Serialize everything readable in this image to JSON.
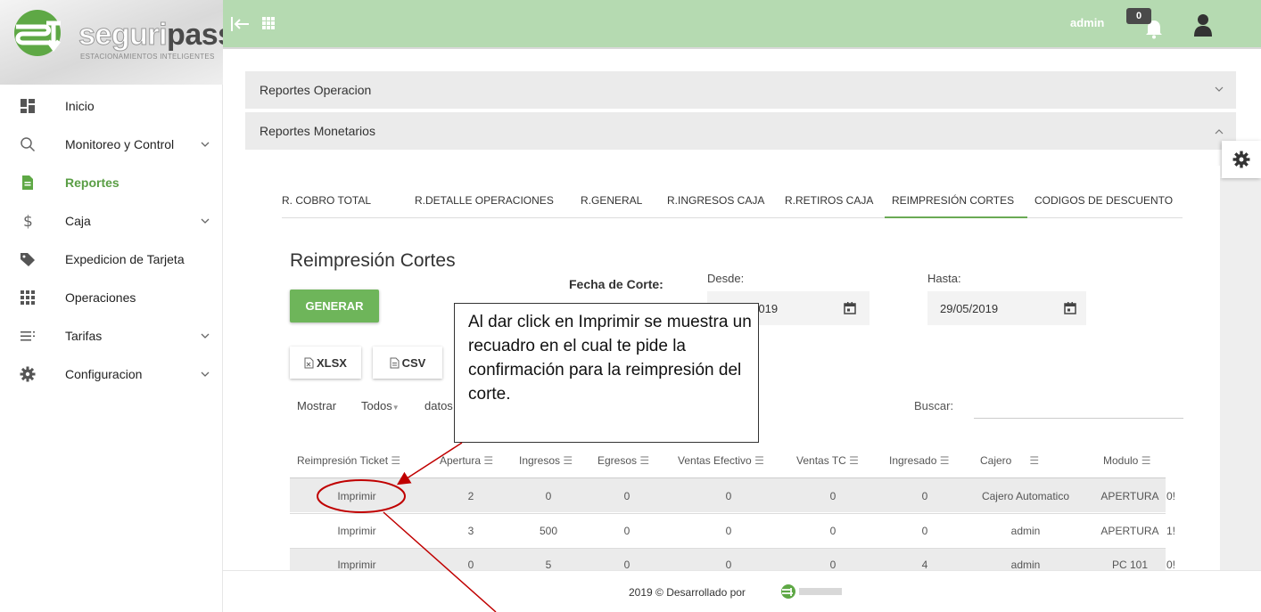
{
  "brand": {
    "logo_name_a": "seguri",
    "logo_name_b": "pass",
    "logo_tagline": "ESTACIONAMIENTOS INTELIGENTES"
  },
  "sidebar": {
    "items": [
      {
        "label": "Inicio",
        "icon": "dashboard-icon"
      },
      {
        "label": "Monitoreo y Control",
        "icon": "search-icon",
        "expandable": true
      },
      {
        "label": "Reportes",
        "icon": "document-icon",
        "active": true
      },
      {
        "label": "Caja",
        "icon": "dollar-icon",
        "expandable": true
      },
      {
        "label": "Expedicion de Tarjeta",
        "icon": "tag-icon"
      },
      {
        "label": "Operaciones",
        "icon": "grid-icon"
      },
      {
        "label": "Tarifas",
        "icon": "list-icon",
        "expandable": true
      },
      {
        "label": "Configuracion",
        "icon": "gear-icon",
        "expandable": true
      }
    ]
  },
  "header": {
    "user": "admin",
    "notifications": "0"
  },
  "accordions": [
    {
      "title": "Reportes Operacion",
      "state": "collapsed"
    },
    {
      "title": "Reportes Monetarios",
      "state": "expanded"
    }
  ],
  "tabs": [
    "R. COBRO TOTAL",
    "R.DETALLE OPERACIONES",
    "R.GENERAL",
    "R.INGRESOS CAJA",
    "R.RETIROS CAJA",
    "REIMPRESIÓN CORTES",
    "CODIGOS DE DESCUENTO"
  ],
  "active_tab": "REIMPRESIÓN CORTES",
  "report": {
    "title": "Reimpresión Cortes",
    "fecha_label": "Fecha de Corte:",
    "desde_label": "Desde:",
    "desde_value": "01/05/2019",
    "hasta_label": "Hasta:",
    "hasta_value": "29/05/2019",
    "generar_label": "GENERAR",
    "xlsx_label": "XLSX",
    "csv_label": "CSV",
    "mostrar_label": "Mostrar",
    "mostrar_value": "Todos",
    "datos_label": "datos",
    "buscar_label": "Buscar:"
  },
  "table": {
    "headers": [
      "Reimpresión Ticket",
      "Apertura",
      "Ingresos",
      "Egresos",
      "Ventas Efectivo",
      "Ventas TC",
      "Ingresado",
      "Cajero",
      "Modulo"
    ],
    "rows": [
      [
        "Imprimir",
        "2",
        "0",
        "0",
        "0",
        "0",
        "0",
        "Cajero Automatico",
        "APERTURA",
        "0!"
      ],
      [
        "Imprimir",
        "3",
        "500",
        "0",
        "0",
        "0",
        "0",
        "admin",
        "APERTURA",
        "1!"
      ],
      [
        "Imprimir",
        "0",
        "5",
        "0",
        "0",
        "0",
        "4",
        "admin",
        "PC 101",
        "0!"
      ]
    ]
  },
  "footer": {
    "text": "2019 © Desarrollado por"
  },
  "annotation": {
    "text": "Al dar click en Imprimir se muestra un recuadro en el cual te pide la confirmación para la reimpresión del corte."
  },
  "colors": {
    "accent": "#6eb55a",
    "topbar": "#b5dab1",
    "annotation_red": "#c00000"
  }
}
